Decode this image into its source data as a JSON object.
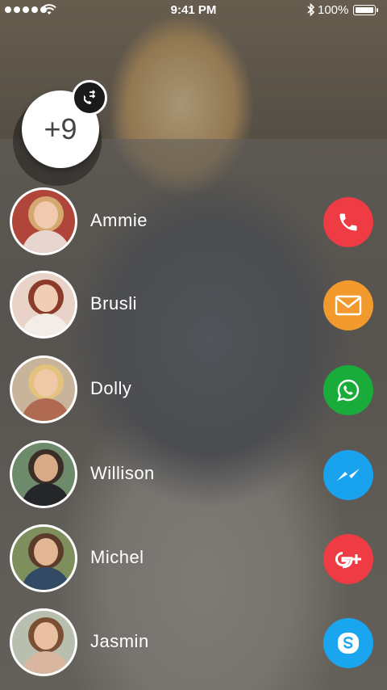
{
  "status_bar": {
    "time": "9:41 PM",
    "battery": "100%"
  },
  "more_contacts": {
    "count_label": "+9",
    "badge_icon": "call-transfer-icon"
  },
  "contacts": [
    {
      "name": "Ammie",
      "action": "phone-icon",
      "color": "#ee3b44"
    },
    {
      "name": "Brusli",
      "action": "mail-icon",
      "color": "#f29a2e"
    },
    {
      "name": "Dolly",
      "action": "whatsapp-icon",
      "color": "#1aac3a"
    },
    {
      "name": "Willison",
      "action": "messenger-icon",
      "color": "#19a2ee"
    },
    {
      "name": "Michel",
      "action": "google-plus-icon",
      "color": "#ee3b44"
    },
    {
      "name": "Jasmin",
      "action": "skype-icon",
      "color": "#1aa6ee"
    }
  ]
}
